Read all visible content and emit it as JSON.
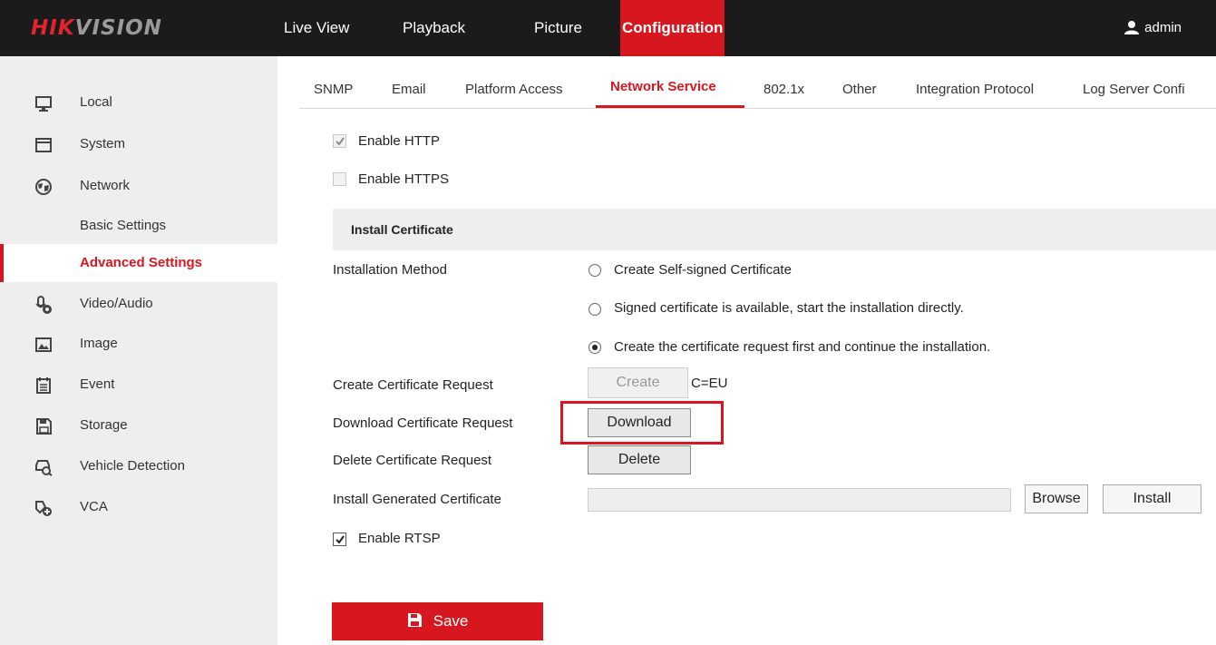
{
  "brand": {
    "part1": "HIK",
    "part2": "VISION"
  },
  "nav": {
    "live_view": "Live View",
    "playback": "Playback",
    "picture": "Picture",
    "configuration": "Configuration"
  },
  "user": {
    "name": "admin",
    "icon": "user-icon"
  },
  "sidebar": {
    "items": [
      {
        "label": "Local",
        "icon": "monitor-icon"
      },
      {
        "label": "System",
        "icon": "window-icon"
      },
      {
        "label": "Network",
        "icon": "globe-icon"
      },
      {
        "label": "Basic Settings"
      },
      {
        "label": "Advanced Settings",
        "active": true
      },
      {
        "label": "Video/Audio",
        "icon": "microphone-icon"
      },
      {
        "label": "Image",
        "icon": "image-icon"
      },
      {
        "label": "Event",
        "icon": "calendar-icon"
      },
      {
        "label": "Storage",
        "icon": "floppy-icon"
      },
      {
        "label": "Vehicle Detection",
        "icon": "car-search-icon"
      },
      {
        "label": "VCA",
        "icon": "vca-icon"
      }
    ]
  },
  "tabs": [
    "SNMP",
    "Email",
    "Platform Access",
    "Network Service",
    "802.1x",
    "Other",
    "Integration Protocol",
    "Log Server Confi"
  ],
  "active_tab": "Network Service",
  "form": {
    "enable_http": {
      "label": "Enable HTTP",
      "checked": true
    },
    "enable_https": {
      "label": "Enable HTTPS",
      "checked": false
    },
    "section_title": "Install Certificate",
    "installation_method_label": "Installation Method",
    "methods": [
      {
        "label": "Create Self-signed Certificate",
        "selected": false
      },
      {
        "label": "Signed certificate is available, start the installation directly.",
        "selected": false
      },
      {
        "label": "Create the certificate request first and continue the installation.",
        "selected": true
      }
    ],
    "create_request_label": "Create Certificate Request",
    "create_button": "Create",
    "create_value": "C=EU",
    "download_request_label": "Download Certificate Request",
    "download_button": "Download",
    "delete_request_label": "Delete Certificate Request",
    "delete_button": "Delete",
    "install_generated_label": "Install Generated Certificate",
    "file_value": "",
    "browse_button": "Browse",
    "install_button": "Install",
    "enable_rtsp": {
      "label": "Enable RTSP",
      "checked": true
    },
    "save_button": "Save"
  },
  "colors": {
    "accent": "#d7171f",
    "topbar": "#1b1b1b",
    "sidebar": "#eeeeee"
  }
}
